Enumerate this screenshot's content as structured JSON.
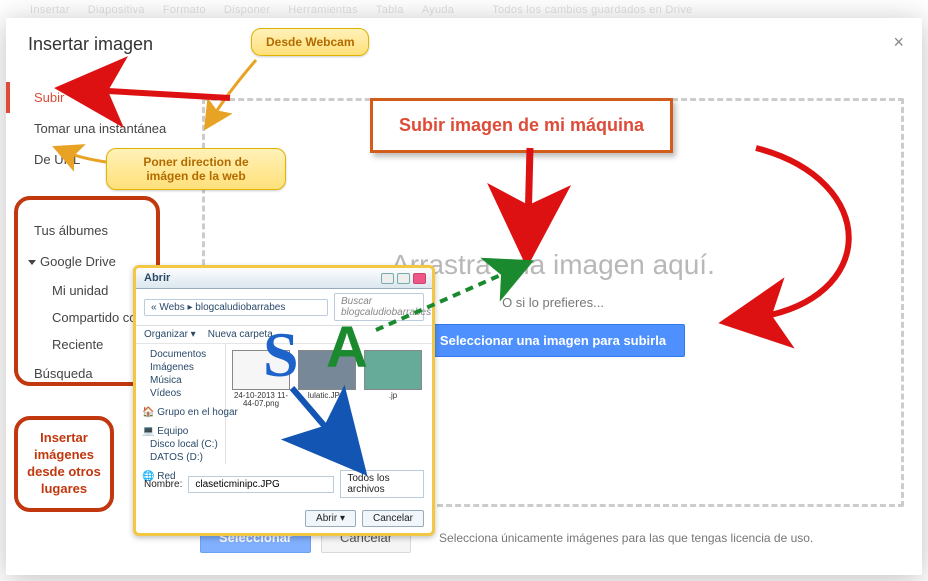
{
  "menubar": {
    "insertar": "Insertar",
    "diapositiva": "Diapositiva",
    "formato": "Formato",
    "disponer": "Disponer",
    "herramientas": "Herramientas",
    "tabla": "Tabla",
    "ayuda": "Ayuda",
    "saved": "Todos los cambios guardados en Drive"
  },
  "dialog": {
    "title": "Insertar imagen"
  },
  "sidebar": {
    "subir": "Subir",
    "instantanea": "Tomar una instantánea",
    "deurl": "De URL",
    "albumes": "Tus álbumes",
    "gdrive": "Google Drive",
    "mi_unidad": "Mi unidad",
    "compartido": "Compartido conmigo",
    "reciente": "Reciente",
    "busqueda": "Búsqueda"
  },
  "dropzone": {
    "big": "Arrastra una imagen aquí.",
    "or": "O si lo prefieres...",
    "select_btn": "Seleccionar una imagen para subirla"
  },
  "footer": {
    "select": "Seleccionar",
    "cancel": "Cancelar",
    "license": "Selecciona únicamente imágenes para las que tengas licencia de uso."
  },
  "annotations": {
    "webcam": "Desde Webcam",
    "url": "Poner direction de imágen de la web",
    "subir_title": "Subir imagen de mi máquina",
    "otros": "Insertar imágenes desde otros lugares"
  },
  "win": {
    "title": "Abrir",
    "path": "«  Webs  ▸  blogcaludiobarrabes",
    "search_ph": "Buscar blogcaludiobarrabes",
    "organizar": "Organizar ▾",
    "nueva": "Nueva carpeta",
    "nav": {
      "documentos": "Documentos",
      "imagenes": "Imágenes",
      "musica": "Música",
      "videos": "Vídeos",
      "grupo": "Grupo en el hogar",
      "equipo": "Equipo",
      "disco": "Disco local (C:)",
      "datos": "DATOS (D:)",
      "red": "Red"
    },
    "file1": "24-10-2013 11-44-07.png",
    "file2": "lulatic.JPG",
    "file3": ".jp",
    "nombre_lbl": "Nombre:",
    "nombre_val": "claseticminipc.JPG",
    "filter": "Todos los archivos",
    "open": "Abrir  ▾",
    "cancel": "Cancelar"
  }
}
